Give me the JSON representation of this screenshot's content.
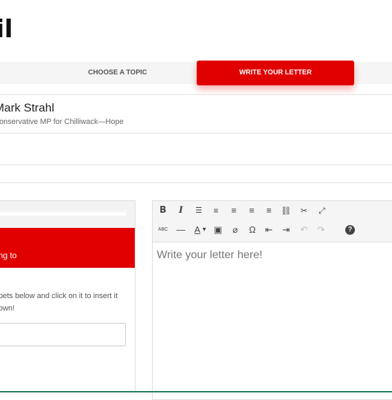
{
  "page": {
    "title_fragment": "il"
  },
  "steps": {
    "topic_label": "CHOOSE A TOPIC",
    "letter_label": "WRITE YOUR LETTER"
  },
  "recipient": {
    "name": "Mark Strahl",
    "description": "Conservative MP for Chilliwack—Hope"
  },
  "left_panel": {
    "banner_text": "ing to",
    "help_line1": "pets below and click on it to insert it",
    "help_line2": "own!"
  },
  "editor": {
    "placeholder": "Write your letter here!",
    "toolbar_row1": [
      "B",
      "I",
      "☰",
      "≡",
      "≡",
      "≡",
      "≡",
      "⛓",
      "✂",
      "⤢"
    ],
    "toolbar_row2": [
      "ABC",
      "—",
      "A",
      "▾",
      "▣",
      "⌀",
      "Ω",
      "⇤",
      "⇥",
      "↶",
      "↷",
      "?"
    ]
  },
  "colors": {
    "accent": "#e00000",
    "bottom_bar": "#1a7a55"
  }
}
